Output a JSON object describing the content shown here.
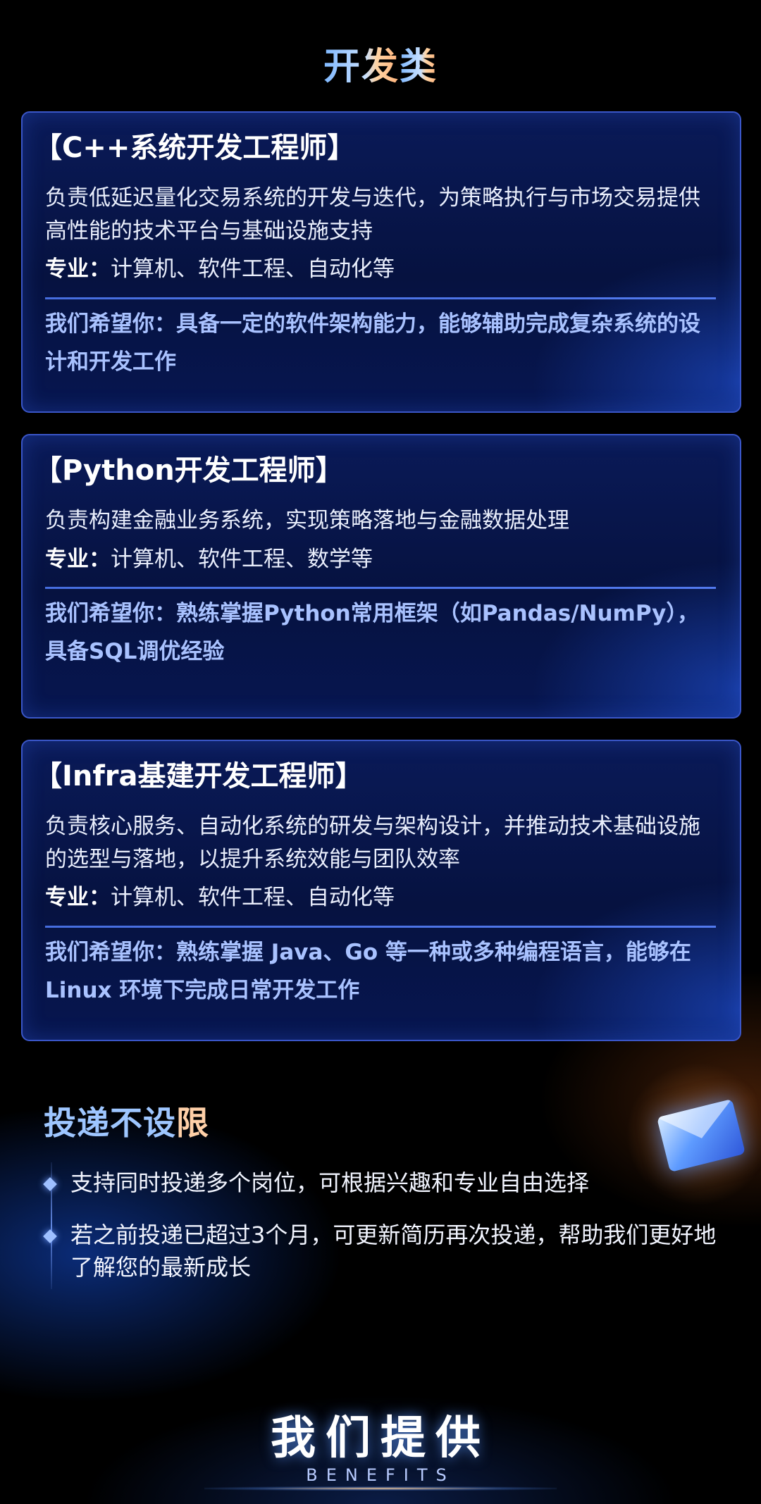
{
  "section": {
    "title_main": "开发",
    "title_accent": "类"
  },
  "jobs": [
    {
      "role": "【C++系统开发工程师】",
      "description": "负责低延迟量化交易系统的开发与迭代，为策略执行与市场交易提供高性能的技术平台与基础设施支持",
      "major_label": "专业：",
      "major_value": "计算机、软件工程、自动化等",
      "hope": "我们希望你：具备一定的软件架构能力，能够辅助完成复杂系统的设计和开发工作"
    },
    {
      "role": "【Python开发工程师】",
      "description": "负责构建金融业务系统，实现策略落地与金融数据处理",
      "major_label": "专业：",
      "major_value": "计算机、软件工程、数学等",
      "hope": "我们希望你：熟练掌握Python常用框架（如Pandas/NumPy），具备SQL调优经验"
    },
    {
      "role": "【Infra基建开发工程师】",
      "description": "负责核心服务、自动化系统的研发与架构设计，并推动技术基础设施的选型与落地，以提升系统效能与团队效率",
      "major_label": "专业：",
      "major_value": "计算机、软件工程、自动化等",
      "hope": "我们希望你：熟练掌握 Java、Go 等一种或多种编程语言，能够在 Linux 环境下完成日常开发工作"
    }
  ],
  "no_limit": {
    "title_main": "投递不设",
    "title_accent": "限",
    "bullets": [
      "支持同时投递多个岗位，可根据兴趣和专业自由选择",
      "若之前投递已超过3个月，可更新简历再次投递，帮助我们更好地了解您的最新成长"
    ]
  },
  "benefits": {
    "title": "我们提供",
    "subtitle": "BENEFITS"
  },
  "colors": {
    "card_border": "#3a56c8",
    "hope_text": "#a9c2ff",
    "accent_orange": "#ffb27a",
    "accent_blue": "#7fb8ff"
  }
}
